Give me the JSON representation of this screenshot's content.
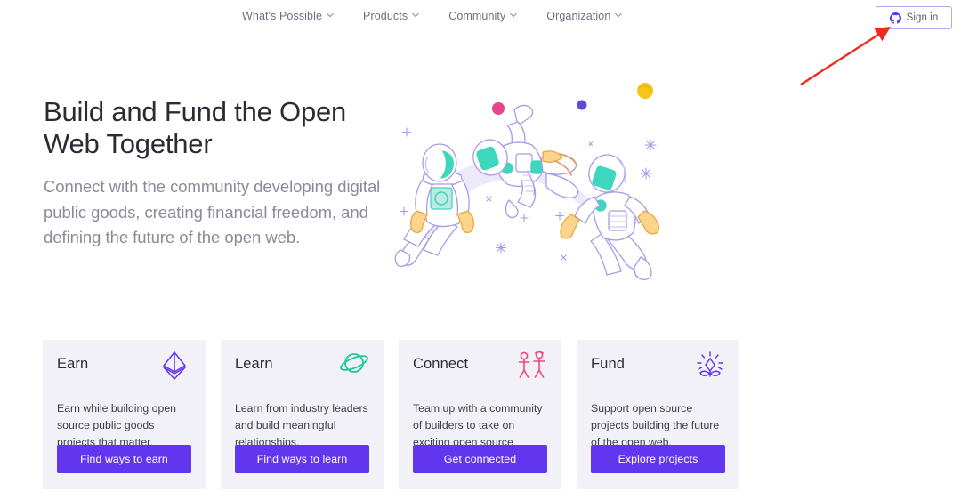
{
  "nav": {
    "items": [
      {
        "label": "What's Possible",
        "icon": "chevron-down-icon"
      },
      {
        "label": "Products",
        "icon": "chevron-down-icon"
      },
      {
        "label": "Community",
        "icon": "chevron-down-icon"
      },
      {
        "label": "Organization",
        "icon": "chevron-down-icon"
      }
    ],
    "signin": {
      "label": "Sign in",
      "icon": "github-icon"
    }
  },
  "hero": {
    "title": "Build and Fund the Open Web Together",
    "subtitle": "Connect with the community developing digital public goods, creating financial freedom, and defining the future of the open web.",
    "illustration": {
      "name": "astronauts-in-space-illustration",
      "line_color": "#a99ae8",
      "accent_teal": "#3ed6bd",
      "accent_gold": "#f7c873",
      "swoosh_color": "#eceafa",
      "planets": [
        {
          "name": "pink-planet",
          "color": "#e8468c"
        },
        {
          "name": "blue-dot",
          "color": "#5b4bd6"
        },
        {
          "name": "yellow-planet",
          "color": "#f5c518"
        }
      ]
    }
  },
  "cards": [
    {
      "title": "Earn",
      "icon": "ethereum-diamond-icon",
      "icon_color": "#6236ef",
      "description": "Earn while building open source public goods projects that matter.",
      "button": "Find ways to earn"
    },
    {
      "title": "Learn",
      "icon": "planet-ring-icon",
      "icon_color": "#19c997",
      "description": "Learn from industry leaders and build meaningful relationships.",
      "button": "Find ways to learn"
    },
    {
      "title": "Connect",
      "icon": "two-people-icon",
      "icon_color": "#f4447c",
      "description": "Team up with a community of builders to take on exciting open source projects.",
      "button": "Get connected"
    },
    {
      "title": "Fund",
      "icon": "sprout-sparkle-icon",
      "icon_color": "#6236ef",
      "description": "Support open source projects building the future of the open web.",
      "button": "Explore projects"
    }
  ],
  "annotation": {
    "name": "red-arrow-pointing-to-sign-in",
    "color": "#ef2b1f"
  },
  "colors": {
    "accent_purple": "#6236ef",
    "card_bg": "#f2f1f8",
    "page_bg": "#ffffff",
    "heading": "#2b2b36",
    "muted_text": "#8a8a99"
  }
}
